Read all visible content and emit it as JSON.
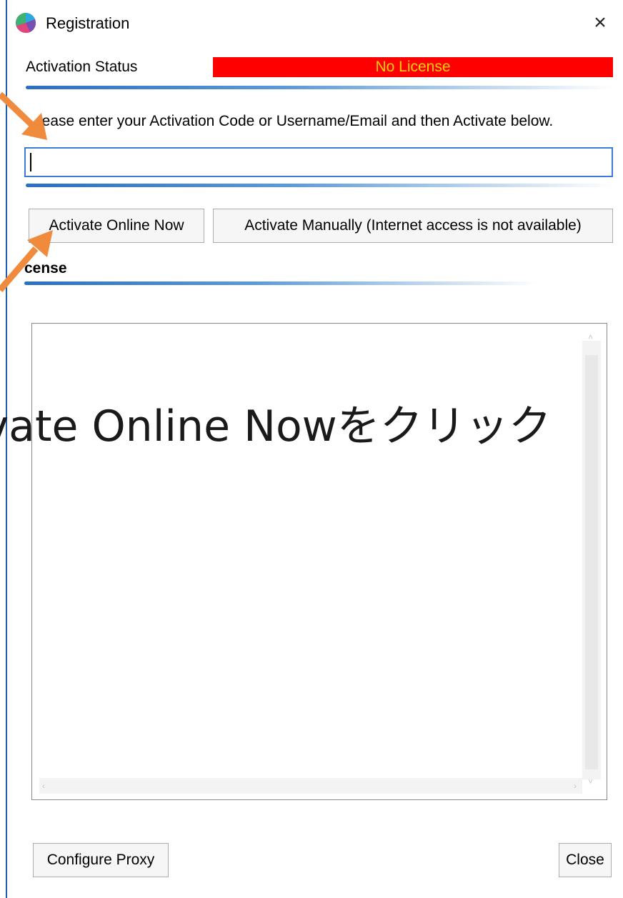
{
  "window": {
    "title": "Registration",
    "close_glyph": "×"
  },
  "activation": {
    "status_label": "Activation Status",
    "status_value": "No License",
    "status_bg_color": "#ff0000",
    "status_text_color": "#ffd200"
  },
  "instruction": "lease enter your Activation Code or Username/Email and then Activate below.",
  "code_input": {
    "value": "",
    "placeholder": ""
  },
  "buttons": {
    "activate_online": "Activate Online Now",
    "activate_manual": "Activate Manually (Internet access is not available)",
    "configure_proxy": "Configure Proxy",
    "close": "Close"
  },
  "license": {
    "section_label": "cense",
    "content": ""
  },
  "annotation": {
    "text": "ivate Online Nowをクリック",
    "arrow_color": "#f08a3c"
  },
  "icons": {
    "app": "app-logo-icon",
    "close": "close-icon",
    "annotation_arrows": "arrow-icon"
  }
}
